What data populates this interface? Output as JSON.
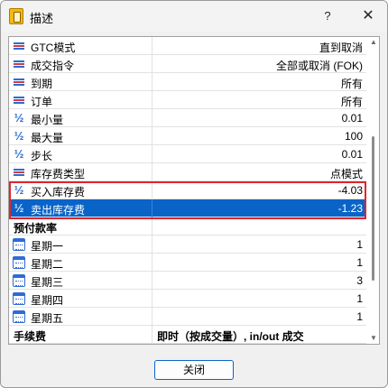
{
  "window": {
    "title": "描述",
    "help_symbol": "?",
    "close_symbol": "✕"
  },
  "rows": [
    {
      "icon": "list-icon",
      "label": "GTC模式",
      "value": "直到取消"
    },
    {
      "icon": "list-icon",
      "label": "成交指令",
      "value": "全部或取消 (FOK)"
    },
    {
      "icon": "list-icon",
      "label": "到期",
      "value": "所有"
    },
    {
      "icon": "list-icon",
      "label": "订单",
      "value": "所有"
    },
    {
      "icon": "half-icon",
      "label": "最小量",
      "value": "0.01"
    },
    {
      "icon": "half-icon",
      "label": "最大量",
      "value": "100"
    },
    {
      "icon": "half-icon",
      "label": "步长",
      "value": "0.01"
    },
    {
      "icon": "list-icon",
      "label": "库存费类型",
      "value": "点模式"
    },
    {
      "icon": "half-icon",
      "label": "买入库存费",
      "value": "-4.03"
    },
    {
      "icon": "half-icon",
      "label": "卖出库存费",
      "value": "-1.23",
      "selected": true
    },
    {
      "section": true,
      "label": "预付款率",
      "value": ""
    },
    {
      "icon": "calendar-icon",
      "label": "星期一",
      "value": "1"
    },
    {
      "icon": "calendar-icon",
      "label": "星期二",
      "value": "1"
    },
    {
      "icon": "calendar-icon",
      "label": "星期三",
      "value": "3"
    },
    {
      "icon": "calendar-icon",
      "label": "星期四",
      "value": "1"
    },
    {
      "icon": "calendar-icon",
      "label": "星期五",
      "value": "1"
    },
    {
      "section": true,
      "label": "手续费",
      "value": "即时（按成交量）, in/out 成交"
    }
  ],
  "icon_glyphs": {
    "half-icon": "½",
    "scroll-up": "▲",
    "scroll-down": "▼"
  },
  "colors": {
    "selected_row": "#0a64c8",
    "highlight_border": "#e0252b",
    "icon_blue": "#2e6bd6"
  },
  "footer": {
    "close_label": "关闭"
  }
}
